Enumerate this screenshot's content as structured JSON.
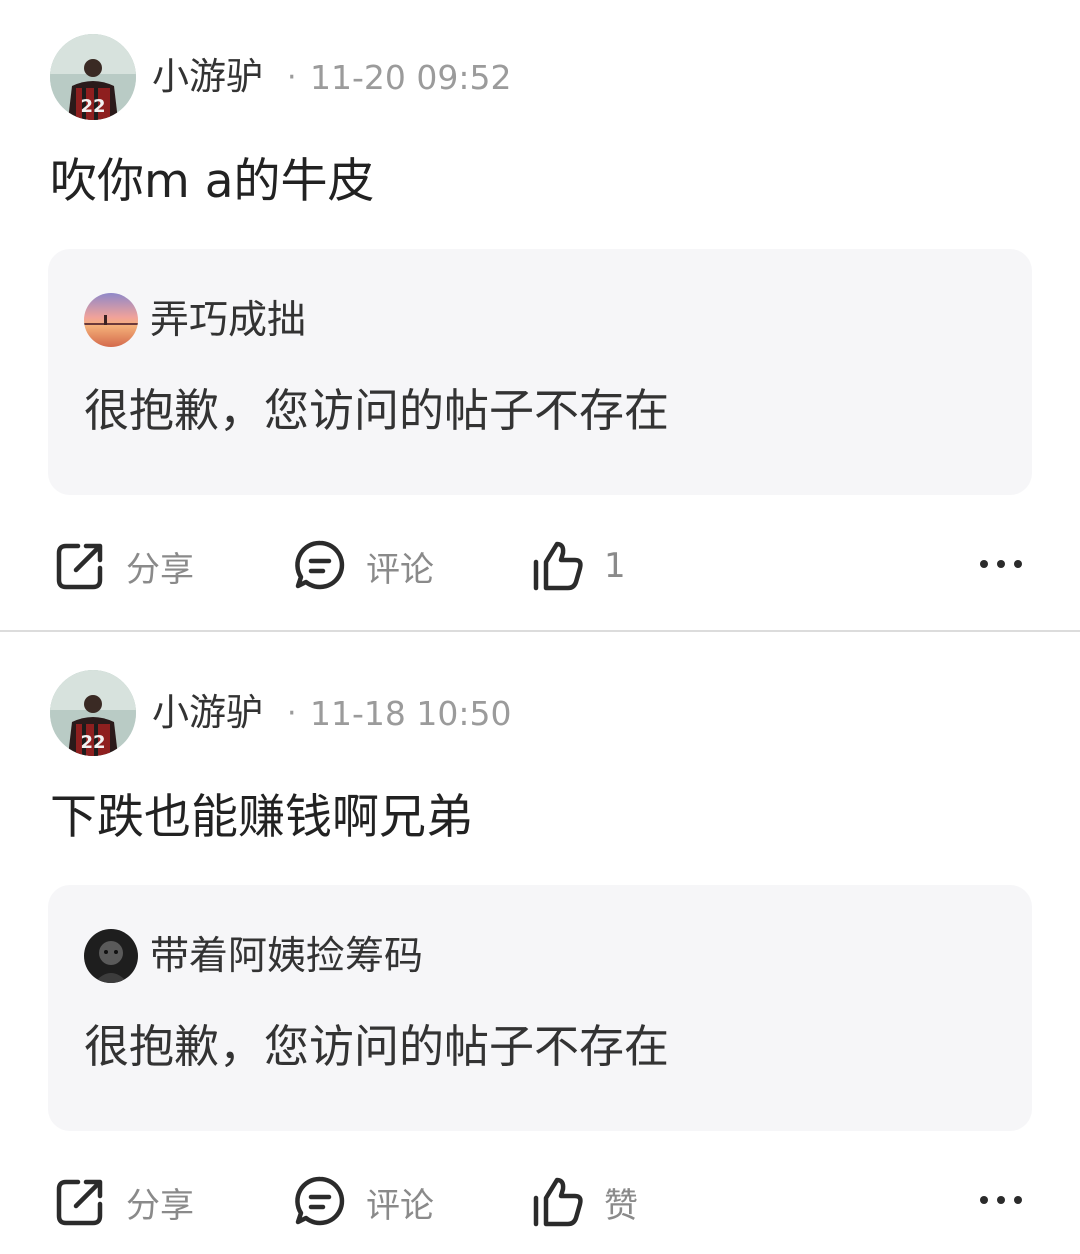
{
  "posts": [
    {
      "author": "小游驴",
      "separator": "·",
      "timestamp": "11-20 09:52",
      "text": "吹你m a的牛皮",
      "jersey_number": "22",
      "quote": {
        "author": "弄巧成拙",
        "text": "很抱歉，您访问的帖子不存在"
      },
      "actions": {
        "share_label": "分享",
        "comment_label": "评论",
        "like_label": "1"
      }
    },
    {
      "author": "小游驴",
      "separator": "·",
      "timestamp": "11-18 10:50",
      "text": "下跌也能赚钱啊兄弟",
      "jersey_number": "22",
      "quote": {
        "author": "带着阿姨捡筹码",
        "text": "很抱歉，您访问的帖子不存在"
      },
      "actions": {
        "share_label": "分享",
        "comment_label": "评论",
        "like_label": "赞"
      }
    }
  ],
  "icons": {
    "share": "share-icon",
    "comment": "comment-icon",
    "like": "thumbs-up-icon",
    "more": "more-options-icon"
  },
  "colors": {
    "card_background": "#f6f6f8",
    "muted_text": "#9b9b9b",
    "icon_stroke": "#2b2b2b",
    "divider": "#dcdcdc"
  }
}
